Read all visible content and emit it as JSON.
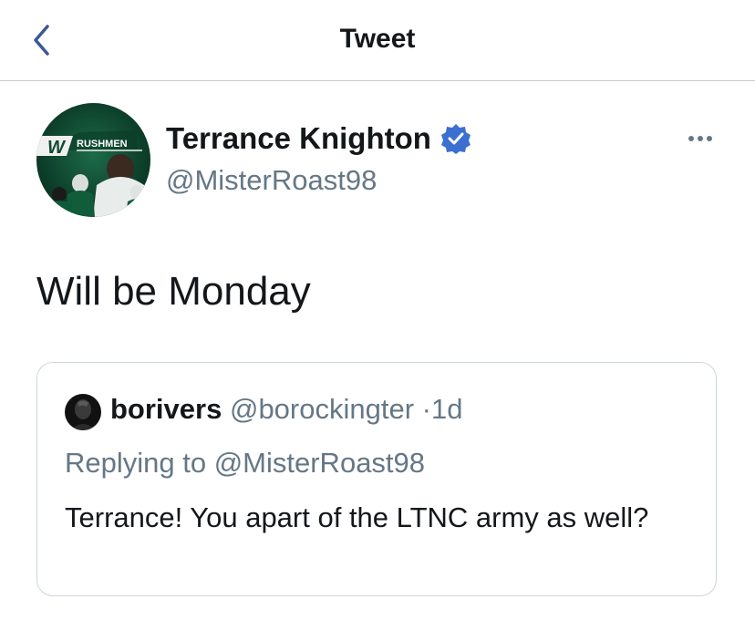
{
  "header": {
    "title": "Tweet",
    "back_icon": "chevron-left-icon"
  },
  "tweet": {
    "author_name": "Terrance Knighton",
    "author_handle": "@MisterRoast98",
    "verified_icon": "verified-badge-icon",
    "avatar_logo_text": "RUSHMEN",
    "text": "Will be Monday",
    "more_icon": "more-horizontal-icon"
  },
  "quoted_tweet": {
    "author_name": "borivers",
    "author_handle": "@borockingter",
    "separator": "·",
    "time": "1d",
    "replying_to": "Replying to @MisterRoast98",
    "text": "Terrance! You apart of the LTNC army as well?"
  },
  "colors": {
    "accent_blue": "#3b5998",
    "verified_blue": "#3b6fd1",
    "secondary_text": "#657786",
    "primary_text": "#14171a",
    "avatar_green": "#0e4a32"
  }
}
